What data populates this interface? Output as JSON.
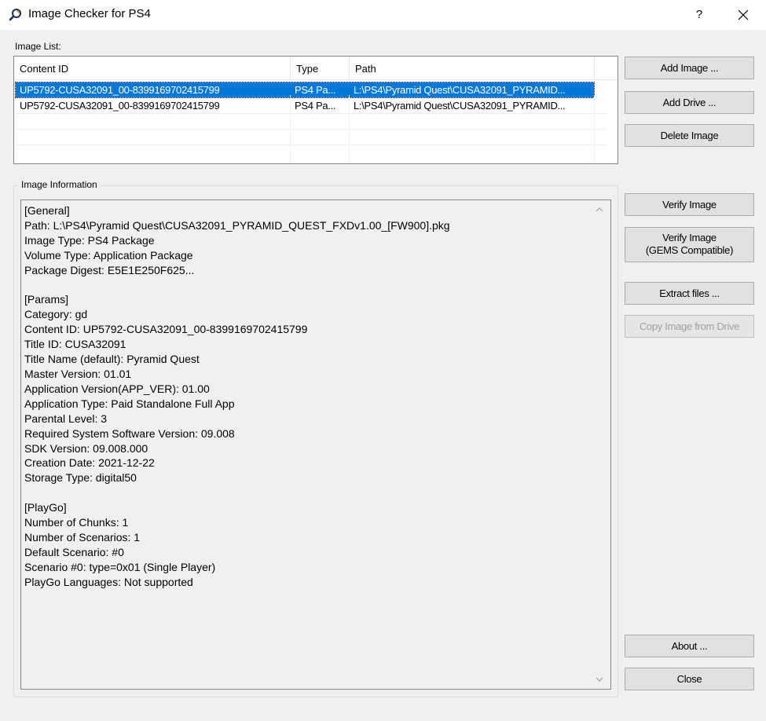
{
  "window": {
    "title": "Image Checker for PS4",
    "help_label": "?"
  },
  "image_list": {
    "label": "Image List:",
    "columns": [
      "Content ID",
      "Type",
      "Path"
    ],
    "rows": [
      [
        "UP5792-CUSA32091_00-8399169702415799",
        "PS4 Pa...",
        "L:\\PS4\\Pyramid Quest\\CUSA32091_PYRAMID..."
      ],
      [
        "UP5792-CUSA32091_00-8399169702415799",
        "PS4 Pa...",
        "L:\\PS4\\Pyramid Quest\\CUSA32091_PYRAMID..."
      ]
    ],
    "selected_row": 0
  },
  "image_information": {
    "label": "Image Information",
    "text": "[General]\nPath: L:\\PS4\\Pyramid Quest\\CUSA32091_PYRAMID_QUEST_FXDv1.00_[FW900].pkg\nImage Type: PS4 Package\nVolume Type: Application Package\nPackage Digest: E5E1E250F625...\n\n[Params]\nCategory: gd\nContent ID: UP5792-CUSA32091_00-8399169702415799\nTitle ID: CUSA32091\nTitle Name (default): Pyramid Quest\nMaster Version: 01.01\nApplication Version(APP_VER): 01.00\nApplication Type: Paid Standalone Full App\nParental Level: 3\nRequired System Software Version: 09.008\nSDK Version: 09.008.000\nCreation Date: 2021-12-22\nStorage Type: digital50\n\n[PlayGo]\nNumber of Chunks: 1\nNumber of Scenarios: 1\nDefault Scenario: #0\nScenario #0: type=0x01 (Single Player)\nPlayGo Languages: Not supported"
  },
  "buttons": {
    "add_image": "Add Image ...",
    "add_drive": "Add Drive ...",
    "delete_image": "Delete Image",
    "verify_image": "Verify Image",
    "verify_gems_line1": "Verify Image",
    "verify_gems_line2": "(GEMS Compatible)",
    "extract_files": "Extract files ...",
    "copy_image": "Copy Image from Drive",
    "about": "About ...",
    "close": "Close"
  },
  "colors": {
    "selection": "#0078d7",
    "window_bg": "#f0f0f0"
  }
}
